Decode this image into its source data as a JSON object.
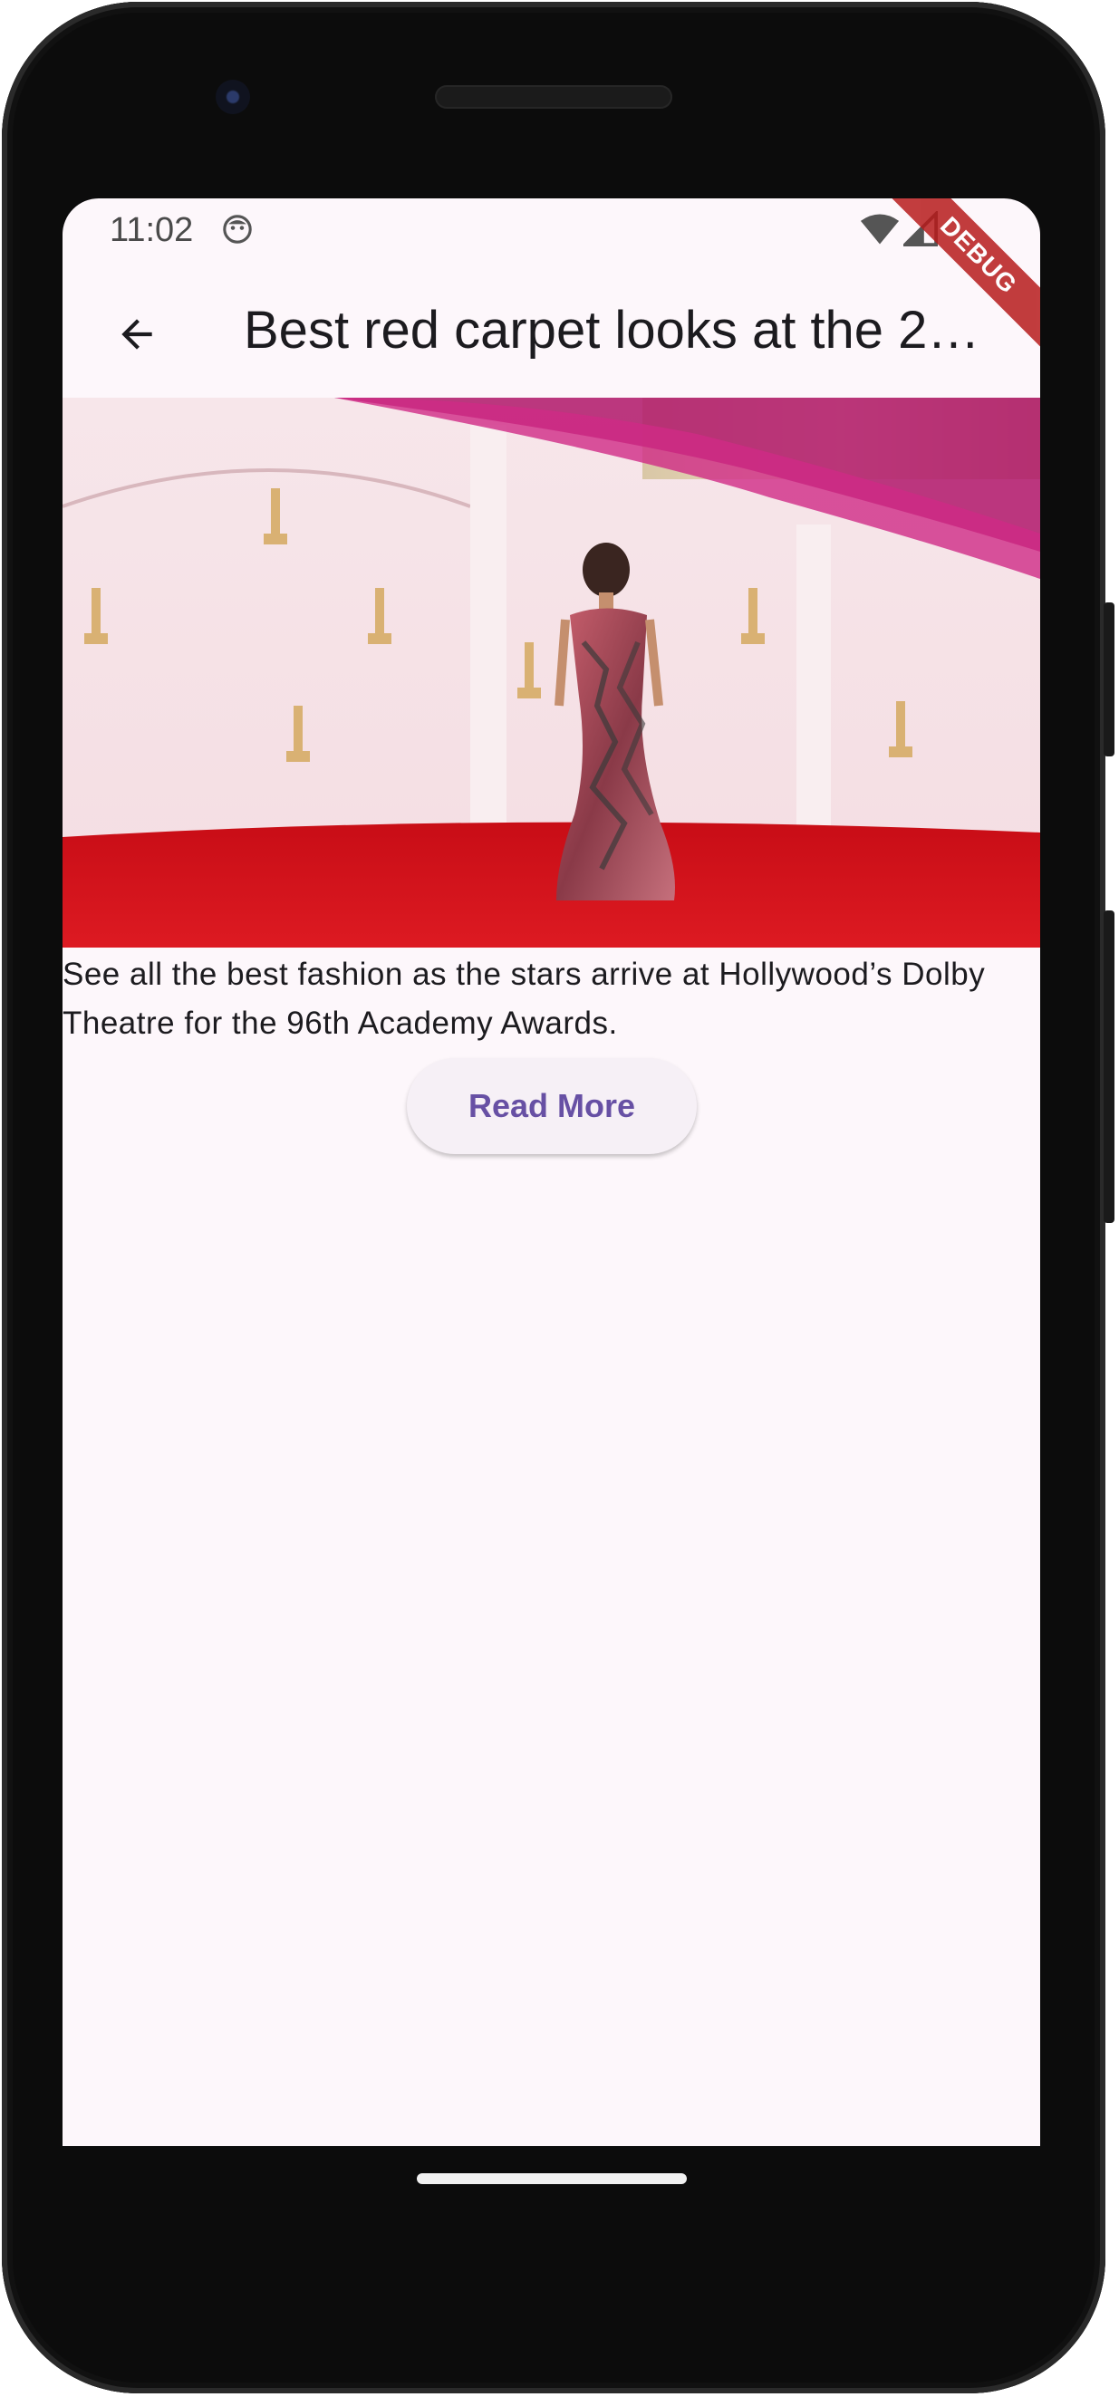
{
  "status_bar": {
    "time": "11:02",
    "debug_label": "DEBUG"
  },
  "app_bar": {
    "title": "Best red carpet looks at the 2…",
    "back_icon": "arrow-back-icon"
  },
  "article": {
    "image_description_icon": "red-carpet-photo",
    "caption": "See all the best fashion as the stars arrive at Hollywood’s Dolby Theatre for the 96th Academy Awards.",
    "read_more_label": "Read More"
  },
  "colors": {
    "background": "#fdf7fb",
    "accent": "#6750a4",
    "debug_banner": "#b71c1c",
    "carpet": "#d0101a"
  }
}
